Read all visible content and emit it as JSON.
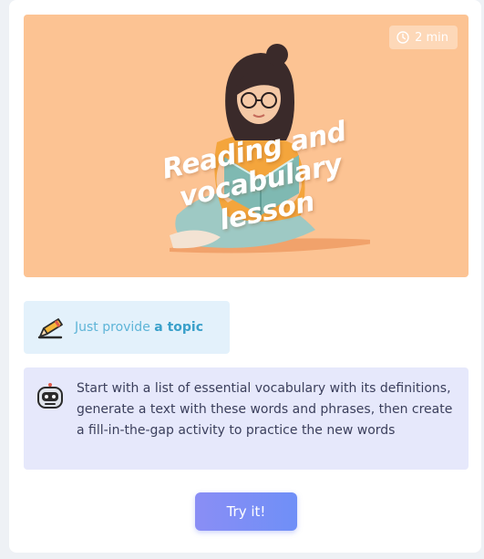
{
  "hero": {
    "duration": "2 min",
    "title_lines": [
      "Reading and",
      "vocabulary",
      "lesson"
    ]
  },
  "topic": {
    "prefix": "Just provide ",
    "emphasis": "a topic"
  },
  "description": {
    "text": "Start with a list of essential vocabulary with its definitions, generate a text with these words and phrases, then create a fill-in-the-gap activity to practice the new words"
  },
  "action": {
    "try_label": "Try it!"
  },
  "colors": {
    "hero_bg": "#fcc393",
    "topic_bg": "#e3f1fb",
    "desc_bg": "#e6e8fb",
    "button": "#7a8ef6"
  },
  "icons": {
    "duration": "clock-icon",
    "topic": "pencil-icon",
    "description": "robot-icon"
  }
}
